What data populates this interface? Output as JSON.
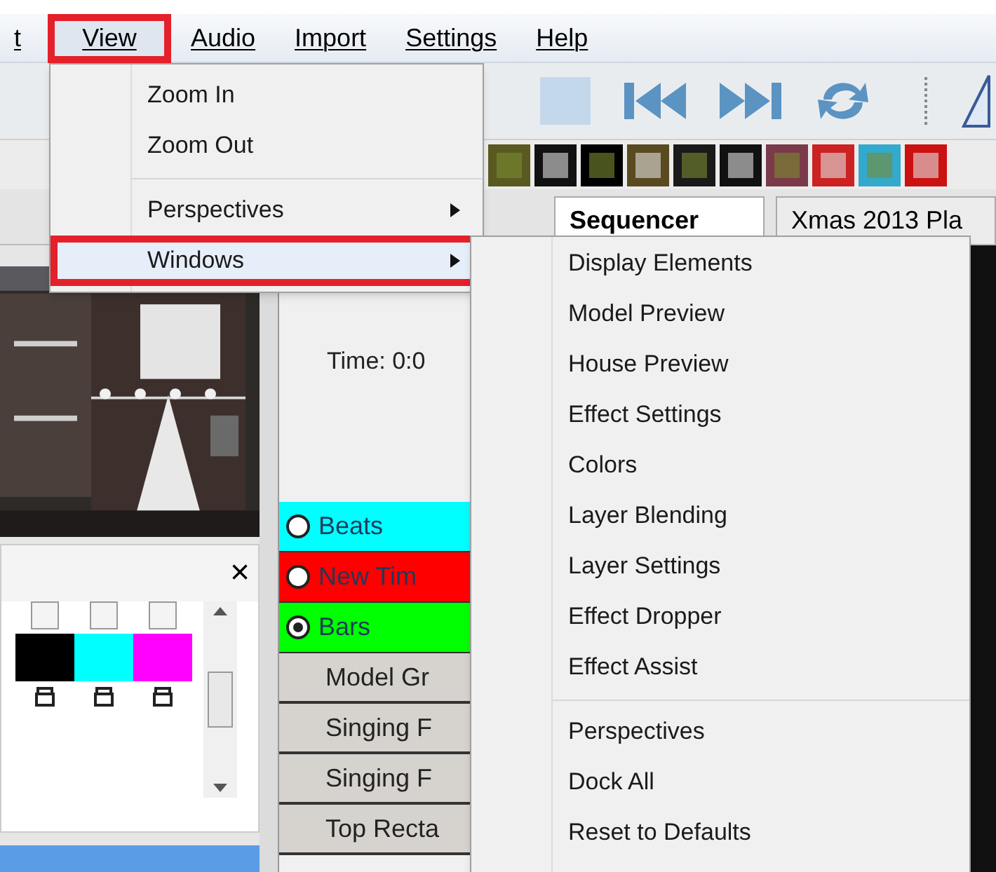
{
  "menubar": [
    {
      "label": "t",
      "selected": false,
      "annotated": false
    },
    {
      "label": "View",
      "selected": true,
      "annotated": true
    },
    {
      "label": "Audio",
      "selected": false,
      "annotated": false
    },
    {
      "label": "Import",
      "selected": false,
      "annotated": false
    },
    {
      "label": "Settings",
      "selected": false,
      "annotated": false
    },
    {
      "label": "Help",
      "selected": false,
      "annotated": false
    }
  ],
  "view_menu": {
    "items": [
      {
        "kind": "item",
        "label": "Zoom In",
        "annotated": false
      },
      {
        "kind": "item",
        "label": "Zoom Out",
        "annotated": false
      },
      {
        "kind": "separator"
      },
      {
        "kind": "submenu",
        "label": "Perspectives",
        "annotated": false
      },
      {
        "kind": "submenu",
        "label": "Windows",
        "annotated": true
      }
    ]
  },
  "windows_submenu": {
    "items": [
      {
        "kind": "item",
        "label": "Display Elements"
      },
      {
        "kind": "item",
        "label": "Model Preview"
      },
      {
        "kind": "item",
        "label": "House Preview"
      },
      {
        "kind": "item",
        "label": "Effect Settings"
      },
      {
        "kind": "item",
        "label": "Colors"
      },
      {
        "kind": "item",
        "label": "Layer Blending"
      },
      {
        "kind": "item",
        "label": "Layer Settings"
      },
      {
        "kind": "item",
        "label": "Effect Dropper"
      },
      {
        "kind": "item",
        "label": "Effect Assist"
      },
      {
        "kind": "separator"
      },
      {
        "kind": "item",
        "label": "Perspectives"
      },
      {
        "kind": "item",
        "label": "Dock All"
      },
      {
        "kind": "item",
        "label": "Reset to Defaults"
      }
    ]
  },
  "tabs": [
    {
      "label": "Sequencer",
      "selected": true
    },
    {
      "label": "Xmas 2013 Pla",
      "selected": false
    }
  ],
  "time_label": "Time: 0:0",
  "colors_panel": {
    "close": "×",
    "swatches": [
      {
        "color": "#000000",
        "checked": false
      },
      {
        "color": "#00ffff",
        "checked": false
      },
      {
        "color": "#ff00ff",
        "checked": false
      }
    ]
  },
  "rows": [
    {
      "kind": "timing",
      "label": "Beats",
      "color": "#00ffff",
      "selected": false
    },
    {
      "kind": "timing",
      "label": "New Tim",
      "color": "#ff0000",
      "selected": false
    },
    {
      "kind": "timing",
      "label": "Bars",
      "color": "#00ff00",
      "selected": true
    },
    {
      "kind": "model",
      "label": "Model Gr"
    },
    {
      "kind": "model",
      "label": "Singing F"
    },
    {
      "kind": "model",
      "label": "Singing F"
    },
    {
      "kind": "model",
      "label": "Top Recta"
    }
  ]
}
